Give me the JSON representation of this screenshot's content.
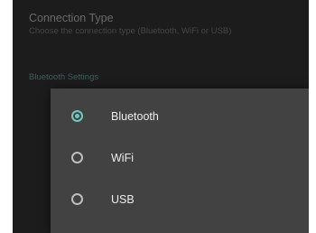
{
  "settings": {
    "connection_type": {
      "title": "Connection Type",
      "summary": "Choose the connection type (Bluetooth, WiFi or USB)"
    },
    "bluetooth_category": "Bluetooth Settings"
  },
  "dialog": {
    "options": [
      {
        "label": "Bluetooth",
        "selected": true
      },
      {
        "label": "WiFi",
        "selected": false
      },
      {
        "label": "USB",
        "selected": false
      }
    ]
  },
  "colors": {
    "accent": "#6fc8bd",
    "panel_background": "#262626",
    "dialog_background": "#424242"
  }
}
